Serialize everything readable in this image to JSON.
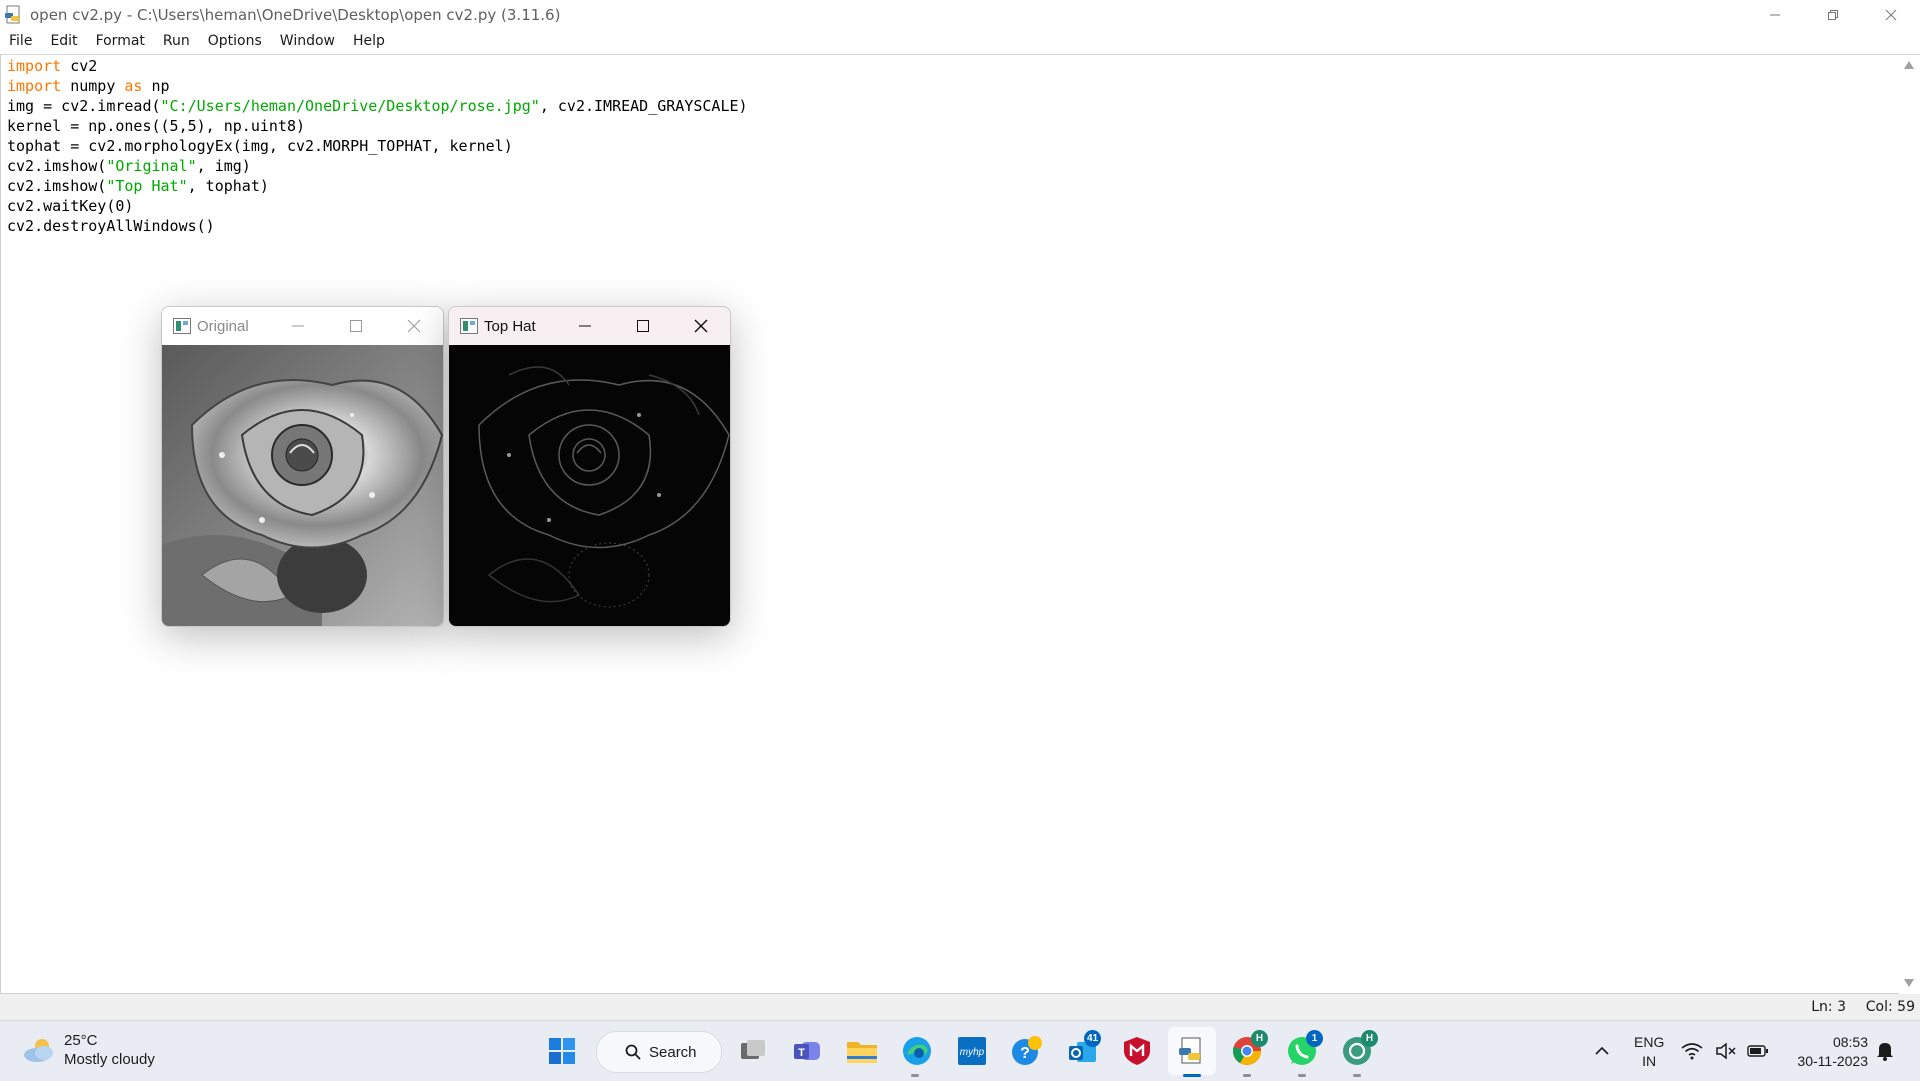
{
  "window": {
    "title": "open cv2.py - C:\\Users\\heman\\OneDrive\\Desktop\\open cv2.py (3.11.6)"
  },
  "menu": [
    "File",
    "Edit",
    "Format",
    "Run",
    "Options",
    "Window",
    "Help"
  ],
  "code_lines": [
    [
      {
        "t": "import",
        "c": "kw"
      },
      {
        "t": " cv2",
        "c": ""
      }
    ],
    [
      {
        "t": "import",
        "c": "kw"
      },
      {
        "t": " numpy ",
        "c": ""
      },
      {
        "t": "as",
        "c": "kw"
      },
      {
        "t": " np",
        "c": ""
      }
    ],
    [
      {
        "t": "img = cv2.imread(",
        "c": ""
      },
      {
        "t": "\"C:/Users/heman/OneDrive/Desktop/rose.jpg\"",
        "c": "str"
      },
      {
        "t": ", cv2.IMREAD_GRAYSCALE)",
        "c": ""
      }
    ],
    [
      {
        "t": "kernel = np.ones((5,5), np.uint8)",
        "c": ""
      }
    ],
    [
      {
        "t": "tophat = cv2.morphologyEx(img, cv2.MORPH_TOPHAT, kernel)",
        "c": ""
      }
    ],
    [
      {
        "t": "cv2.imshow(",
        "c": ""
      },
      {
        "t": "\"Original\"",
        "c": "str"
      },
      {
        "t": ", img)",
        "c": ""
      }
    ],
    [
      {
        "t": "cv2.imshow(",
        "c": ""
      },
      {
        "t": "\"Top Hat\"",
        "c": "str"
      },
      {
        "t": ", tophat)",
        "c": ""
      }
    ],
    [
      {
        "t": "cv2.waitKey(0)",
        "c": ""
      }
    ],
    [
      {
        "t": "cv2.destroyAllWindows()",
        "c": ""
      }
    ]
  ],
  "status": {
    "line": "Ln: 3",
    "col": "Col: 59"
  },
  "cv_windows": {
    "original": {
      "title": "Original"
    },
    "tophat": {
      "title": "Top Hat"
    }
  },
  "taskbar": {
    "weather_temp": "25°C",
    "weather_desc": "Mostly cloudy",
    "search_label": "Search",
    "badges": {
      "outlook": "41",
      "whatsapp": "1",
      "chrome": "H",
      "chatgpt": "H"
    },
    "lang_1": "ENG",
    "lang_2": "IN",
    "time": "08:53",
    "date": "30-11-2023"
  },
  "colors": {
    "keyword": "#ff7700",
    "string": "#00aa00",
    "accent": "#0067c0"
  }
}
